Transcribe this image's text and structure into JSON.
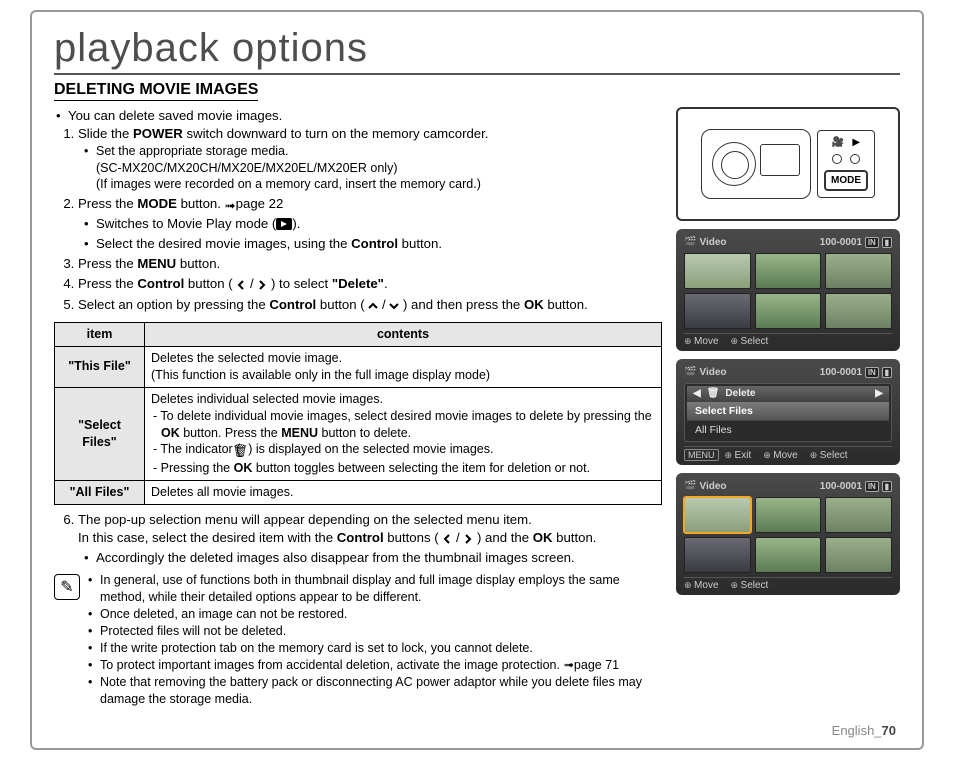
{
  "title": "playback options",
  "section_heading": "DELETING MOVIE IMAGES",
  "intro": "You can delete saved movie images.",
  "steps": {
    "s1": "Slide the ",
    "s1_bold": "POWER",
    "s1_rest": " switch downward to turn on the memory camcorder.",
    "s1_sub1": "Set the appropriate storage media.",
    "s1_models": "(SC-MX20C/MX20CH/MX20E/MX20EL/MX20ER only)",
    "s1_sub2": "(If images were recorded on a memory card, insert the memory card.)",
    "s2": "Press the ",
    "s2_bold": "MODE",
    "s2_rest": " button. ",
    "s2_ref": "page 22",
    "s2_sub1a": "Switches to Movie Play mode (",
    "s2_sub1b": ").",
    "s2_sub2a": "Select the desired movie images, using the ",
    "s2_sub2_bold": "Control",
    "s2_sub2b": " button.",
    "s3": "Press the ",
    "s3_bold": "MENU",
    "s3_rest": " button.",
    "s4a": "Press the ",
    "s4_bold": "Control",
    "s4b": " button (",
    "s4c": ") to select ",
    "s4_quote": "\"Delete\"",
    "s4d": ".",
    "s5a": "Select an option by pressing the ",
    "s5_bold1": "Control",
    "s5b": " button (",
    "s5c": ") and then press the ",
    "s5_bold2": "OK",
    "s5d": " button."
  },
  "table": {
    "h_item": "item",
    "h_contents": "contents",
    "r1_item": "\"This File\"",
    "r1_c": "Deletes the selected movie image.\n(This function is available only in the full image display mode)",
    "r2_item": "\"Select Files\"",
    "r2_l1": "Deletes individual selected movie images.",
    "r2_l2a": "To delete individual movie images, select desired movie images to delete by pressing the ",
    "r2_l2_bold1": "OK",
    "r2_l2b": " button. Press the ",
    "r2_l2_bold2": "MENU",
    "r2_l2c": " button to delete.",
    "r2_l3a": "The indicator (",
    "r2_l3b": ") is displayed on the selected movie images.",
    "r2_l4a": "Pressing the ",
    "r2_l4_bold": "OK",
    "r2_l4b": " button toggles between selecting the item for deletion or not.",
    "r3_item": "\"All Files\"",
    "r3_c": "Deletes all movie images."
  },
  "step6": {
    "a": "The pop-up selection menu will appear depending on the selected menu item.",
    "b1": "In this case, select the desired item with the ",
    "b_bold1": "Control",
    "b2": " buttons (",
    "b3": ") and the ",
    "b_bold2": "OK",
    "b4": " button.",
    "sub": "Accordingly the deleted images also disappear from the thumbnail images screen."
  },
  "notes": {
    "n1": "In general, use of functions both in thumbnail display and full image display employs the same method, while their detailed options appear to be different.",
    "n2": "Once deleted, an image can not be restored.",
    "n3": "Protected files will not be deleted.",
    "n4": "If the write protection tab on the memory card is set to lock, you cannot delete.",
    "n5a": "To protect important images from accidental deletion, activate the image protection. ",
    "n5_ref": "page 71",
    "n6": "Note that removing the battery pack or disconnecting AC power adaptor while you delete files may damage the storage media."
  },
  "footer": {
    "label": "English_",
    "page": "70"
  },
  "right": {
    "mode_label": "MODE",
    "lcd1": {
      "title": "Video",
      "counter": "100-0001",
      "move": "Move",
      "select": "Select"
    },
    "lcd2": {
      "title": "Video",
      "counter": "100-0001",
      "menu_title": "Delete",
      "row_sel": "Select Files",
      "row_all": "All Files",
      "exit": "Exit",
      "move": "Move",
      "select": "Select",
      "menu_btn": "MENU"
    },
    "lcd3": {
      "title": "Video",
      "counter": "100-0001",
      "move": "Move",
      "select": "Select"
    }
  }
}
